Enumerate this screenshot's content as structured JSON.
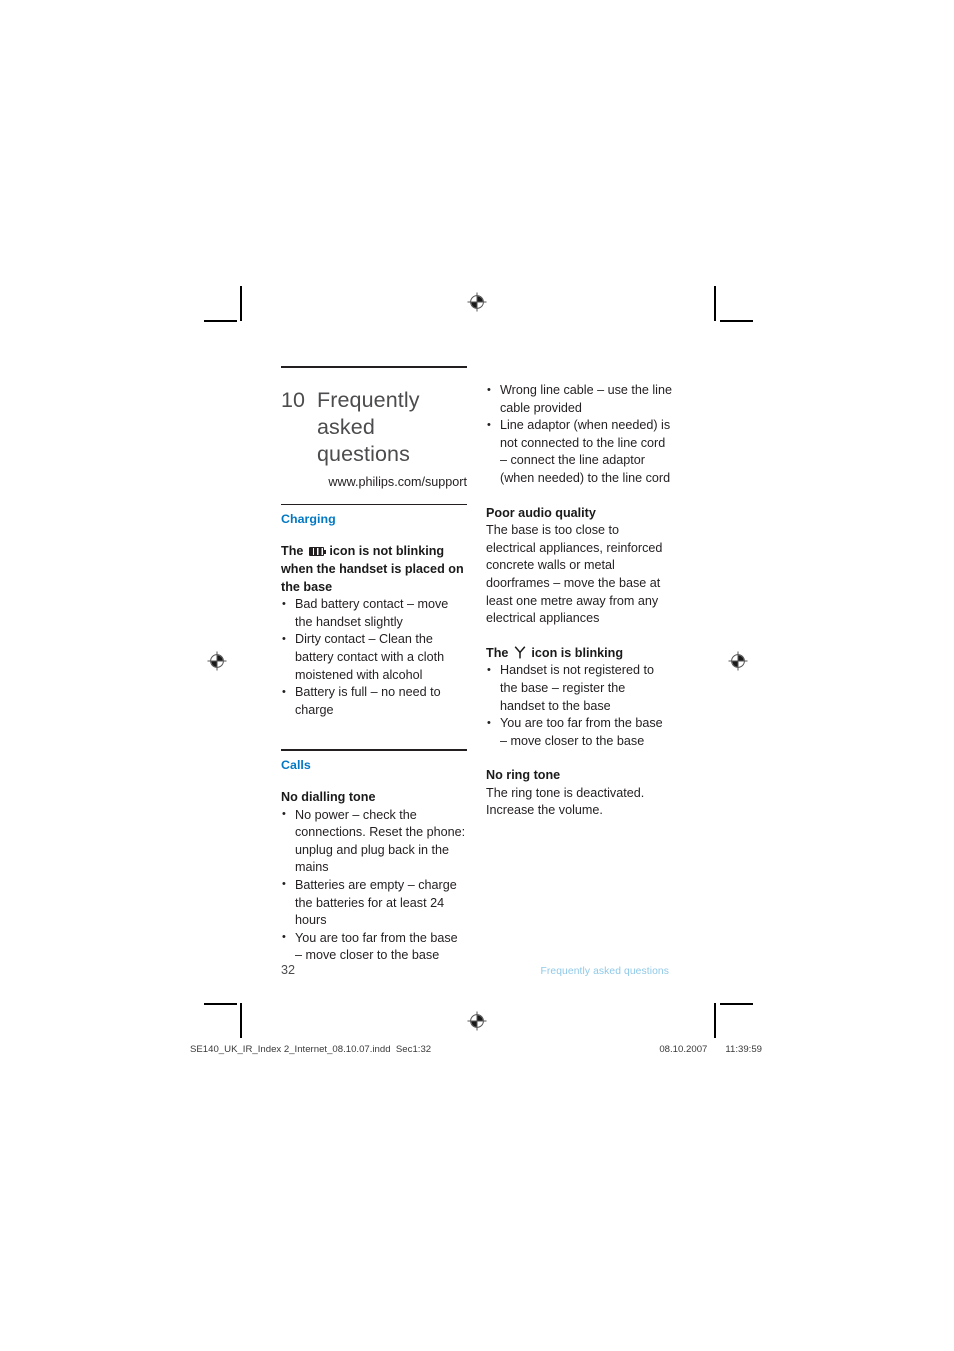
{
  "document": {
    "chapter_number": "10",
    "chapter_title": "Frequently asked questions",
    "support_url": "www.philips.com/support",
    "page_number": "32",
    "footer_label": "Frequently asked questions",
    "accent_color": "#0278c4",
    "footer_color": "#8fc9e8"
  },
  "left_column": {
    "section_charging": {
      "heading": "Charging",
      "entries": [
        {
          "subhead_before_icon": "The ",
          "icon": "battery-icon",
          "subhead_after_icon": " icon is not blinking when the handset is placed on the base",
          "bullets": [
            "Bad battery contact – move the handset slightly",
            "Dirty contact – Clean the battery contact with a cloth moistened with alcohol",
            "Battery is full – no need to charge"
          ]
        }
      ]
    },
    "section_calls": {
      "heading": "Calls",
      "entries": [
        {
          "subhead": "No dialling tone",
          "bullets": [
            "No power – check the connections. Reset the phone: unplug and plug back in the mains",
            "Batteries are empty – charge the batteries for at least 24 hours",
            "You are too far from the base – move closer to the base"
          ]
        }
      ]
    }
  },
  "right_column": {
    "continued_bullets": [
      "Wrong line cable – use the line cable provided",
      "Line adaptor (when needed) is not connected to the line cord – connect the line adaptor (when needed) to the line cord"
    ],
    "entries": [
      {
        "subhead": "Poor audio quality",
        "paragraph": "The base is too close to electrical appliances, reinforced concrete walls or metal doorframes – move the base at least one metre away from any electrical appliances"
      },
      {
        "subhead_before_icon": "The ",
        "icon": "antenna-icon",
        "subhead_after_icon": " icon is blinking",
        "bullets": [
          "Handset is not registered to the base – register the handset to the base",
          "You are too far from the base – move closer to the base"
        ]
      },
      {
        "subhead": "No ring tone",
        "paragraph": "The ring tone is deactivated. Increase the volume."
      }
    ]
  },
  "print_slug": {
    "file_name": "SE140_UK_IR_Index 2_Internet_08.10.07.indd",
    "section": "Sec1:32",
    "date": "08.10.2007",
    "time": "11:39:59"
  }
}
